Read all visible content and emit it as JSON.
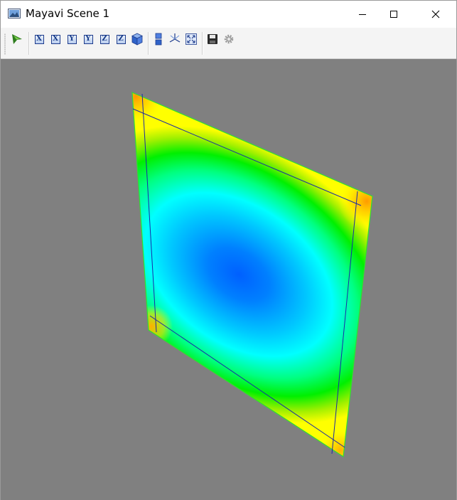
{
  "window": {
    "title": "Mayavi Scene 1",
    "controls": [
      "minimize",
      "maximize",
      "close"
    ]
  },
  "toolbar": {
    "buttons": [
      {
        "icon": "mayavi-pipeline-icon",
        "tooltip": ""
      },
      {
        "icon": "view-x-plus-icon",
        "glyph": "X"
      },
      {
        "icon": "view-x-minus-icon",
        "glyph": "X"
      },
      {
        "icon": "view-y-plus-icon",
        "glyph": "Y"
      },
      {
        "icon": "view-y-minus-icon",
        "glyph": "Y"
      },
      {
        "icon": "view-z-plus-icon",
        "glyph": "Z"
      },
      {
        "icon": "view-z-minus-icon",
        "glyph": "Z"
      },
      {
        "icon": "isometric-view-icon"
      },
      {
        "icon": "parallel-projection-icon"
      },
      {
        "icon": "toggle-axes-icon"
      },
      {
        "icon": "full-screen-icon"
      },
      {
        "icon": "save-icon"
      },
      {
        "icon": "configure-icon"
      }
    ]
  },
  "scene": {
    "background_color": "#808080",
    "surface_colormap": [
      "#0060ff",
      "#00ffff",
      "#00ff00",
      "#ffff00",
      "#ff8800"
    ],
    "outline_color": "#1020a0"
  }
}
